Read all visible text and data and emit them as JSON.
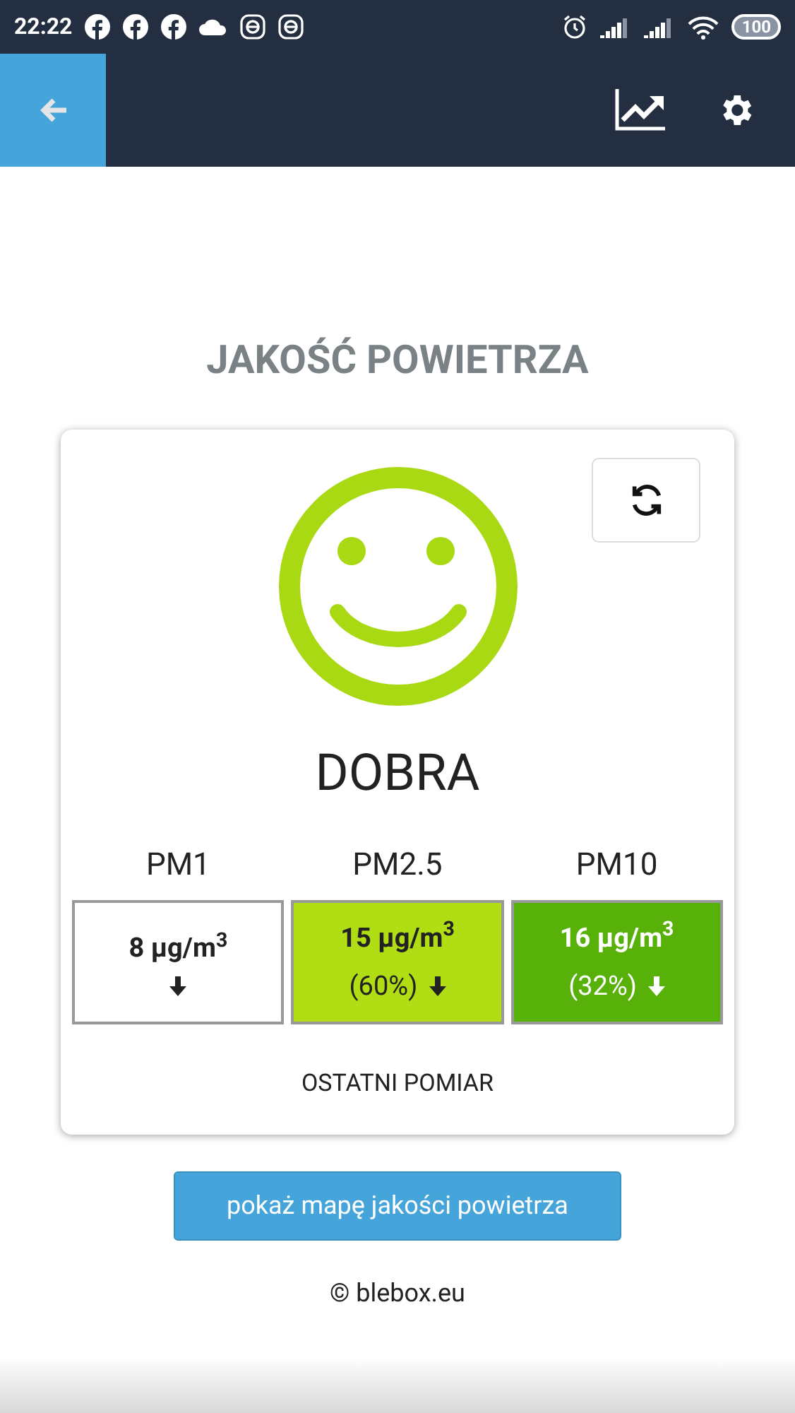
{
  "status_bar": {
    "time": "22:22",
    "battery": "100"
  },
  "title": "JAKOŚĆ POWIETRZA",
  "card": {
    "status": "DOBRA",
    "measurements": [
      {
        "label": "PM1",
        "value": "8 μg/m$^{3}$",
        "color": "#ffffff"
      },
      {
        "label": "PM2.5",
        "value": "15 μg/m$^{3}$",
        "percent": "(60%)",
        "color": "#b0dd14"
      },
      {
        "label": "PM10",
        "value": "16 μg/m$^{3}$",
        "percent": "(32%)",
        "color": "#57b109"
      }
    ],
    "caption": "OSTATNI POMIAR"
  },
  "map_button": "pokaż mapę jakości powietrza",
  "footer": "© blebox.eu"
}
